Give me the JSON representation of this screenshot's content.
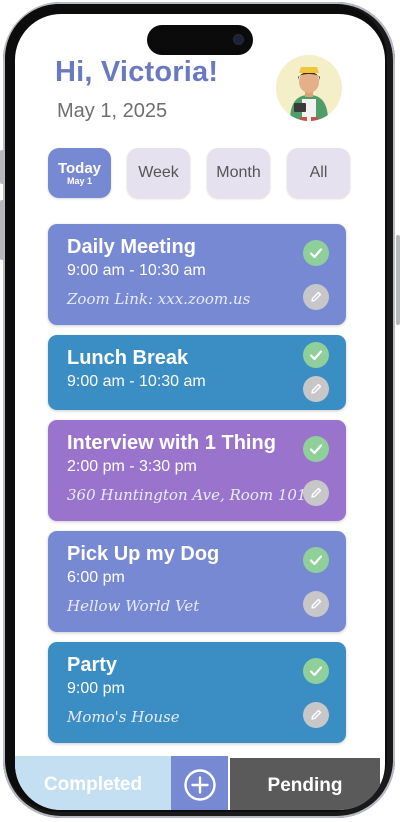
{
  "header": {
    "greeting": "Hi, Victoria!",
    "date": "May 1, 2025"
  },
  "tabs": [
    {
      "label": "Today",
      "sub": "May 1",
      "active": true
    },
    {
      "label": "Week",
      "active": false
    },
    {
      "label": "Month",
      "active": false
    },
    {
      "label": "All",
      "active": false
    }
  ],
  "events": [
    {
      "title": "Daily Meeting",
      "time": "9:00 am - 10:30 am",
      "location": "Zoom Link: xxx.zoom.us",
      "color": "#7889d4"
    },
    {
      "title": "Lunch Break",
      "time": "9:00 am - 10:30 am",
      "location": "",
      "color": "#3b8ec4"
    },
    {
      "title": "Interview with 1 Thing",
      "time": "2:00 pm - 3:30 pm",
      "location": "360 Huntington Ave, Room 101",
      "color": "#9a74cc"
    },
    {
      "title": "Pick Up my Dog",
      "time": "6:00 pm",
      "location": "Hellow World Vet",
      "color": "#7889d4"
    },
    {
      "title": "Party",
      "time": "9:00 pm",
      "location": "Momo's House",
      "color": "#3b8ec4"
    }
  ],
  "bottom": {
    "completed": "Completed",
    "pending": "Pending"
  },
  "colors": {
    "accent": "#7889d4",
    "check": "#8fcf9a",
    "edit": "#c7c7ca"
  },
  "icons": {
    "check": "check-icon",
    "edit": "pencil-icon",
    "add": "plus-circle-icon"
  }
}
